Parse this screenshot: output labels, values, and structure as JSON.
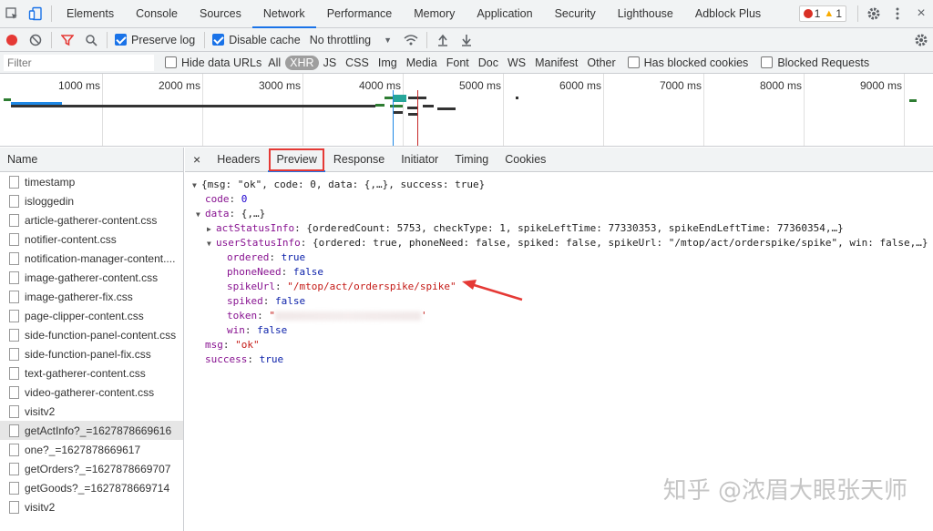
{
  "tabbar": {
    "tabs": [
      "Elements",
      "Console",
      "Sources",
      "Network",
      "Performance",
      "Memory",
      "Application",
      "Security",
      "Lighthouse",
      "Adblock Plus"
    ],
    "active": "Network",
    "error_count": "1",
    "warning_count": "1"
  },
  "toolbar": {
    "preserve_log": "Preserve log",
    "disable_cache": "Disable cache",
    "throttling": "No throttling"
  },
  "filter": {
    "placeholder": "Filter",
    "hide_data_urls": "Hide data URLs",
    "types": [
      "All",
      "XHR",
      "JS",
      "CSS",
      "Img",
      "Media",
      "Font",
      "Doc",
      "WS",
      "Manifest",
      "Other"
    ],
    "selected_type": "XHR",
    "has_blocked_cookies": "Has blocked cookies",
    "blocked_requests": "Blocked Requests"
  },
  "overview": {
    "ticks": [
      "1000 ms",
      "2000 ms",
      "3000 ms",
      "4000 ms",
      "5000 ms",
      "6000 ms",
      "7000 ms",
      "8000 ms",
      "9000 ms"
    ]
  },
  "requests": {
    "header": "Name",
    "items": [
      "timestamp",
      "isloggedin",
      "article-gatherer-content.css",
      "notifier-content.css",
      "notification-manager-content....",
      "image-gatherer-content.css",
      "image-gatherer-fix.css",
      "page-clipper-content.css",
      "side-function-panel-content.css",
      "side-function-panel-fix.css",
      "text-gatherer-content.css",
      "video-gatherer-content.css",
      "visitv2",
      "getActInfo?_=1627878669616",
      "one?_=1627878669617",
      "getOrders?_=1627878669707",
      "getGoods?_=1627878669714",
      "visitv2"
    ],
    "selected_index": 13
  },
  "details": {
    "close": "×",
    "tabs": [
      "Headers",
      "Preview",
      "Response",
      "Initiator",
      "Timing",
      "Cookies"
    ],
    "active": "Preview"
  },
  "preview": {
    "root_summary": "{msg: \"ok\", code: 0, data: {,…}, success: true}",
    "code_key": "code",
    "code_val": "0",
    "data_key": "data",
    "data_summary": "{,…}",
    "act_key": "actStatusInfo",
    "act_summary": "{orderedCount: 5753, checkType: 1, spikeLeftTime: 77330353, spikeEndLeftTime: 77360354,…}",
    "user_key": "userStatusInfo",
    "user_summary": "{ordered: true, phoneNeed: false, spiked: false, spikeUrl: \"/mtop/act/orderspike/spike\", win: false,…}",
    "ordered_key": "ordered",
    "ordered_val": "true",
    "phone_key": "phoneNeed",
    "phone_val": "false",
    "spikeurl_key": "spikeUrl",
    "spikeurl_val": "\"/mtop/act/orderspike/spike\"",
    "spiked_key": "spiked",
    "spiked_val": "false",
    "token_key": "token",
    "win_key": "win",
    "win_val": "false",
    "msg_key": "msg",
    "msg_val": "\"ok\"",
    "success_key": "success",
    "success_val": "true"
  },
  "watermark": "知乎 @浓眉大眼张天师",
  "colors": {
    "accent": "#1a73e8",
    "record": "#e53935",
    "annotation": "#e53935"
  }
}
